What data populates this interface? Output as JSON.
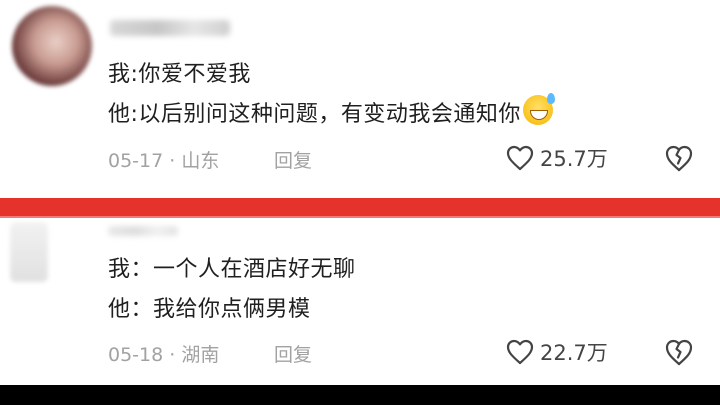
{
  "comments": [
    {
      "lines": [
        "我:你爱不爱我",
        "他:以后别问这种问题，有变动我会通知你"
      ],
      "emoji": "grinning-sweat-emoji",
      "date": "05-17",
      "location": "山东",
      "reply_label": "回复",
      "likes": "25.7万"
    },
    {
      "lines": [
        "我：一个人在酒店好无聊",
        "他：我给你点俩男模"
      ],
      "date": "05-18",
      "location": "湖南",
      "reply_label": "回复",
      "likes": "22.7万"
    }
  ],
  "meta_separator": " · ",
  "colors": {
    "divider": "#e5322a",
    "meta_text": "#a2a2a2",
    "body_text": "#1f1f1f"
  },
  "icons": [
    "heart-outline-icon",
    "broken-heart-icon"
  ]
}
